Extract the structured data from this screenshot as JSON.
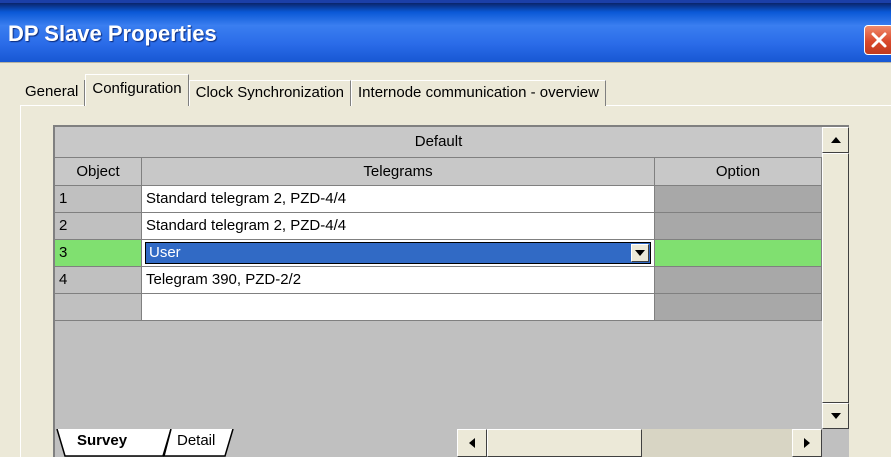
{
  "window": {
    "title": "DP Slave Properties"
  },
  "tabs": [
    {
      "label": "General"
    },
    {
      "label": "Configuration"
    },
    {
      "label": "Clock Synchronization"
    },
    {
      "label": "Internode communication - overview"
    }
  ],
  "active_tab": "Configuration",
  "grid": {
    "group_header": "Default",
    "columns": [
      "Object",
      "Telegrams",
      "Option"
    ],
    "rows": [
      {
        "object": "1",
        "telegram": "Standard telegram 2, PZD-4/4",
        "option": ""
      },
      {
        "object": "2",
        "telegram": "Standard telegram 2, PZD-4/4",
        "option": ""
      },
      {
        "object": "3",
        "telegram": "User",
        "option": ""
      },
      {
        "object": "4",
        "telegram": "Telegram 390, PZD-2/2",
        "option": ""
      },
      {
        "object": "",
        "telegram": "",
        "option": ""
      }
    ],
    "selected_row": 3,
    "dropdown_value": "User"
  },
  "sheet_tabs": [
    {
      "label": "Survey"
    },
    {
      "label": "Detail"
    }
  ],
  "colors": {
    "titlebar": "#2a6be8",
    "selection": "#316ac5",
    "highlight_row": "#80e070",
    "close_button": "#d9492c"
  },
  "icons": {
    "close": "close-icon",
    "dropdown": "chevron-down-icon",
    "scroll_up": "arrow-up-icon",
    "scroll_down": "arrow-down-icon",
    "scroll_left": "arrow-left-icon",
    "scroll_right": "arrow-right-icon"
  }
}
